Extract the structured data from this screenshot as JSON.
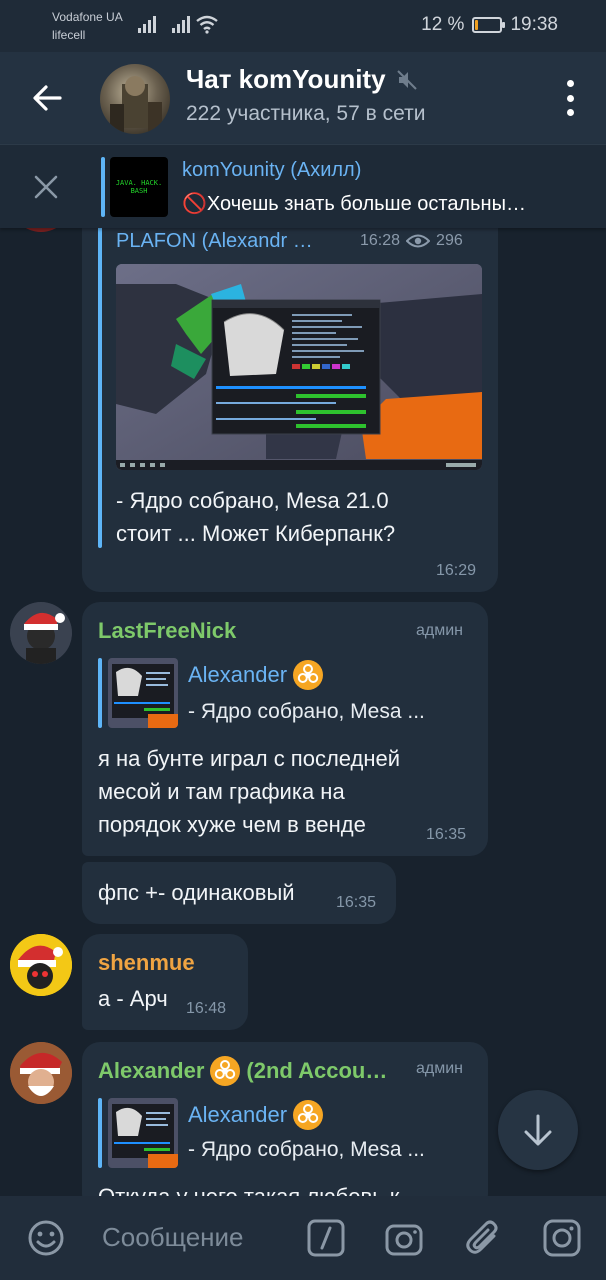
{
  "status_bar": {
    "carrier1": "Vodafone UA",
    "carrier2": "lifecell",
    "battery": "12 %",
    "battery_level": 0.12,
    "time": "19:38"
  },
  "header": {
    "title": "Чат komYounity",
    "subtitle": "222 участника, 57 в сети",
    "muted_icon": "mute-icon"
  },
  "pinned": {
    "thumb_text": "JAVA. HACK. BASH",
    "name": "komYounity (Ахилл)",
    "text": "🚫Хочешь знать больше остальны…"
  },
  "messages": {
    "forward": {
      "name": "PLAFON (Alexandr …",
      "fwd_time": "16:28",
      "views": "296",
      "text_line1": "- Ядро собрано, Mesa 21.0",
      "text_line2": "стоит ... Может Киберпанк?",
      "time": "16:29"
    },
    "m1": {
      "sender": "LastFreeNick",
      "badge": "админ",
      "reply_name": "Alexander",
      "reply_text": "- Ядро собрано, Mesa ...",
      "line1": "я на бунте играл с последней",
      "line2": "месой и там графика на",
      "line3": "порядок хуже чем в венде",
      "time": "16:35"
    },
    "m2": {
      "text": "фпс +- одинаковый",
      "time": "16:35"
    },
    "m3": {
      "sender": "shenmue",
      "text": "а - Арч",
      "time": "16:48"
    },
    "m4": {
      "sender_name": "Alexander",
      "sender_suffix": "(2nd Accou…",
      "badge": "админ",
      "reply_name": "Alexander",
      "reply_text": "- Ядро собрано, Mesa ...",
      "line1": "Откуда у него такая любовь к"
    }
  },
  "input": {
    "placeholder": "Сообщение"
  },
  "colors": {
    "accent": "#6ab3f3",
    "sender_green": "#7ec96a",
    "sender_orange": "#f0a442",
    "bubble": "#222f3d",
    "background": "#18222d"
  }
}
